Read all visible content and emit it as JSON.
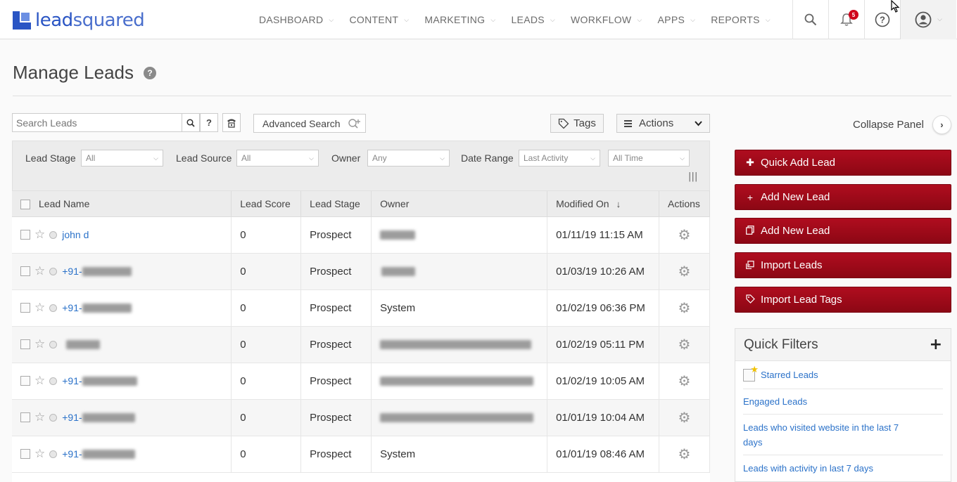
{
  "brand": {
    "name_part1": "lead",
    "name_part2": "squared"
  },
  "nav": {
    "items": [
      {
        "label": "DASHBOARD"
      },
      {
        "label": "CONTENT"
      },
      {
        "label": "MARKETING"
      },
      {
        "label": "LEADS"
      },
      {
        "label": "WORKFLOW"
      },
      {
        "label": "APPS"
      },
      {
        "label": "REPORTS"
      }
    ],
    "notification_count": "5"
  },
  "page": {
    "title": "Manage Leads"
  },
  "toolbar": {
    "search_placeholder": "Search Leads",
    "help_label": "?",
    "advanced_search_label": "Advanced Search",
    "tags_label": "Tags",
    "actions_label": "Actions",
    "collapse_label": "Collapse Panel"
  },
  "filters": {
    "lead_stage": {
      "label": "Lead Stage",
      "value": "All"
    },
    "lead_source": {
      "label": "Lead Source",
      "value": "All"
    },
    "owner": {
      "label": "Owner",
      "value": "Any"
    },
    "date_range": {
      "label": "Date Range",
      "value": "Last Activity",
      "period": "All Time"
    }
  },
  "table": {
    "columns": [
      "Lead Name",
      "Lead Score",
      "Lead Stage",
      "Owner",
      "Modified On",
      "Actions"
    ],
    "sort_indicator": "↓",
    "rows": [
      {
        "name": "john d",
        "score": "0",
        "stage": "Prospect",
        "owner": "",
        "modified": "01/11/19 11:15 AM"
      },
      {
        "name": "+91-",
        "score": "0",
        "stage": "Prospect",
        "owner": "",
        "modified": "01/03/19 10:26 AM"
      },
      {
        "name": "+91-",
        "score": "0",
        "stage": "Prospect",
        "owner": "System",
        "modified": "01/02/19 06:36 PM"
      },
      {
        "name": "",
        "score": "0",
        "stage": "Prospect",
        "owner": "",
        "modified": "01/02/19 05:11 PM"
      },
      {
        "name": "+91-",
        "score": "0",
        "stage": "Prospect",
        "owner": "",
        "modified": "01/02/19 10:05 AM"
      },
      {
        "name": "+91-",
        "score": "0",
        "stage": "Prospect",
        "owner": "",
        "modified": "01/01/19 10:04 AM"
      },
      {
        "name": "+91-",
        "score": "0",
        "stage": "Prospect",
        "owner": "System",
        "modified": "01/01/19 08:46 AM"
      }
    ]
  },
  "panel": {
    "buttons": [
      {
        "label": "Quick Add Lead",
        "icon": "plus-icon"
      },
      {
        "label": "Add New Lead",
        "icon": "plus-icon"
      },
      {
        "label": "Add New Lead",
        "icon": "copy-icon"
      },
      {
        "label": "Import Leads",
        "icon": "import-icon"
      },
      {
        "label": "Import Lead Tags",
        "icon": "tag-icon"
      }
    ],
    "quick_filters": {
      "title": "Quick Filters",
      "items": [
        {
          "label": "Starred Leads"
        },
        {
          "label": "Engaged Leads"
        },
        {
          "label": "Leads who visited website in the last 7 days"
        },
        {
          "label": "Leads with activity in last 7 days"
        }
      ]
    }
  },
  "colors": {
    "accent_red": "#9b0a18",
    "link_blue": "#2b72c9",
    "brand_blue": "#2a55c4"
  }
}
